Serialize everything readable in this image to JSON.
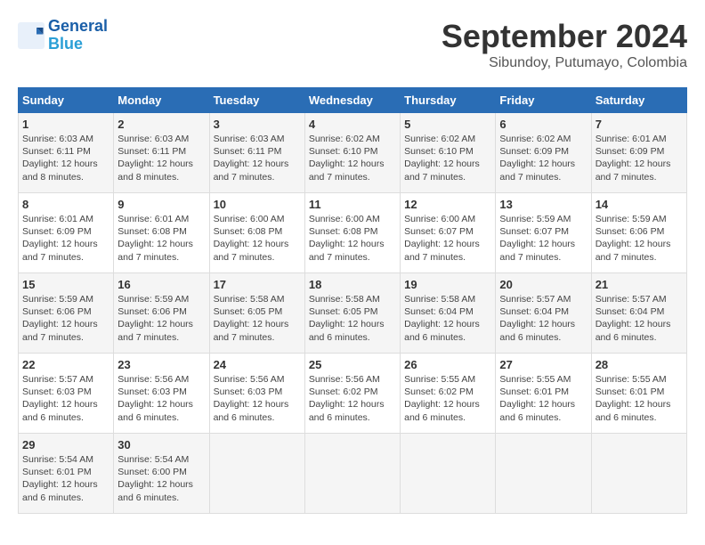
{
  "logo": {
    "line1": "General",
    "line2": "Blue"
  },
  "header": {
    "month": "September 2024",
    "location": "Sibundoy, Putumayo, Colombia"
  },
  "weekdays": [
    "Sunday",
    "Monday",
    "Tuesday",
    "Wednesday",
    "Thursday",
    "Friday",
    "Saturday"
  ],
  "weeks": [
    [
      {
        "day": "1",
        "sunrise": "6:03 AM",
        "sunset": "6:11 PM",
        "daylight": "12 hours and 8 minutes."
      },
      {
        "day": "2",
        "sunrise": "6:03 AM",
        "sunset": "6:11 PM",
        "daylight": "12 hours and 8 minutes."
      },
      {
        "day": "3",
        "sunrise": "6:03 AM",
        "sunset": "6:11 PM",
        "daylight": "12 hours and 7 minutes."
      },
      {
        "day": "4",
        "sunrise": "6:02 AM",
        "sunset": "6:10 PM",
        "daylight": "12 hours and 7 minutes."
      },
      {
        "day": "5",
        "sunrise": "6:02 AM",
        "sunset": "6:10 PM",
        "daylight": "12 hours and 7 minutes."
      },
      {
        "day": "6",
        "sunrise": "6:02 AM",
        "sunset": "6:09 PM",
        "daylight": "12 hours and 7 minutes."
      },
      {
        "day": "7",
        "sunrise": "6:01 AM",
        "sunset": "6:09 PM",
        "daylight": "12 hours and 7 minutes."
      }
    ],
    [
      {
        "day": "8",
        "sunrise": "6:01 AM",
        "sunset": "6:09 PM",
        "daylight": "12 hours and 7 minutes."
      },
      {
        "day": "9",
        "sunrise": "6:01 AM",
        "sunset": "6:08 PM",
        "daylight": "12 hours and 7 minutes."
      },
      {
        "day": "10",
        "sunrise": "6:00 AM",
        "sunset": "6:08 PM",
        "daylight": "12 hours and 7 minutes."
      },
      {
        "day": "11",
        "sunrise": "6:00 AM",
        "sunset": "6:08 PM",
        "daylight": "12 hours and 7 minutes."
      },
      {
        "day": "12",
        "sunrise": "6:00 AM",
        "sunset": "6:07 PM",
        "daylight": "12 hours and 7 minutes."
      },
      {
        "day": "13",
        "sunrise": "5:59 AM",
        "sunset": "6:07 PM",
        "daylight": "12 hours and 7 minutes."
      },
      {
        "day": "14",
        "sunrise": "5:59 AM",
        "sunset": "6:06 PM",
        "daylight": "12 hours and 7 minutes."
      }
    ],
    [
      {
        "day": "15",
        "sunrise": "5:59 AM",
        "sunset": "6:06 PM",
        "daylight": "12 hours and 7 minutes."
      },
      {
        "day": "16",
        "sunrise": "5:59 AM",
        "sunset": "6:06 PM",
        "daylight": "12 hours and 7 minutes."
      },
      {
        "day": "17",
        "sunrise": "5:58 AM",
        "sunset": "6:05 PM",
        "daylight": "12 hours and 7 minutes."
      },
      {
        "day": "18",
        "sunrise": "5:58 AM",
        "sunset": "6:05 PM",
        "daylight": "12 hours and 6 minutes."
      },
      {
        "day": "19",
        "sunrise": "5:58 AM",
        "sunset": "6:04 PM",
        "daylight": "12 hours and 6 minutes."
      },
      {
        "day": "20",
        "sunrise": "5:57 AM",
        "sunset": "6:04 PM",
        "daylight": "12 hours and 6 minutes."
      },
      {
        "day": "21",
        "sunrise": "5:57 AM",
        "sunset": "6:04 PM",
        "daylight": "12 hours and 6 minutes."
      }
    ],
    [
      {
        "day": "22",
        "sunrise": "5:57 AM",
        "sunset": "6:03 PM",
        "daylight": "12 hours and 6 minutes."
      },
      {
        "day": "23",
        "sunrise": "5:56 AM",
        "sunset": "6:03 PM",
        "daylight": "12 hours and 6 minutes."
      },
      {
        "day": "24",
        "sunrise": "5:56 AM",
        "sunset": "6:03 PM",
        "daylight": "12 hours and 6 minutes."
      },
      {
        "day": "25",
        "sunrise": "5:56 AM",
        "sunset": "6:02 PM",
        "daylight": "12 hours and 6 minutes."
      },
      {
        "day": "26",
        "sunrise": "5:55 AM",
        "sunset": "6:02 PM",
        "daylight": "12 hours and 6 minutes."
      },
      {
        "day": "27",
        "sunrise": "5:55 AM",
        "sunset": "6:01 PM",
        "daylight": "12 hours and 6 minutes."
      },
      {
        "day": "28",
        "sunrise": "5:55 AM",
        "sunset": "6:01 PM",
        "daylight": "12 hours and 6 minutes."
      }
    ],
    [
      {
        "day": "29",
        "sunrise": "5:54 AM",
        "sunset": "6:01 PM",
        "daylight": "12 hours and 6 minutes."
      },
      {
        "day": "30",
        "sunrise": "5:54 AM",
        "sunset": "6:00 PM",
        "daylight": "12 hours and 6 minutes."
      },
      null,
      null,
      null,
      null,
      null
    ]
  ]
}
